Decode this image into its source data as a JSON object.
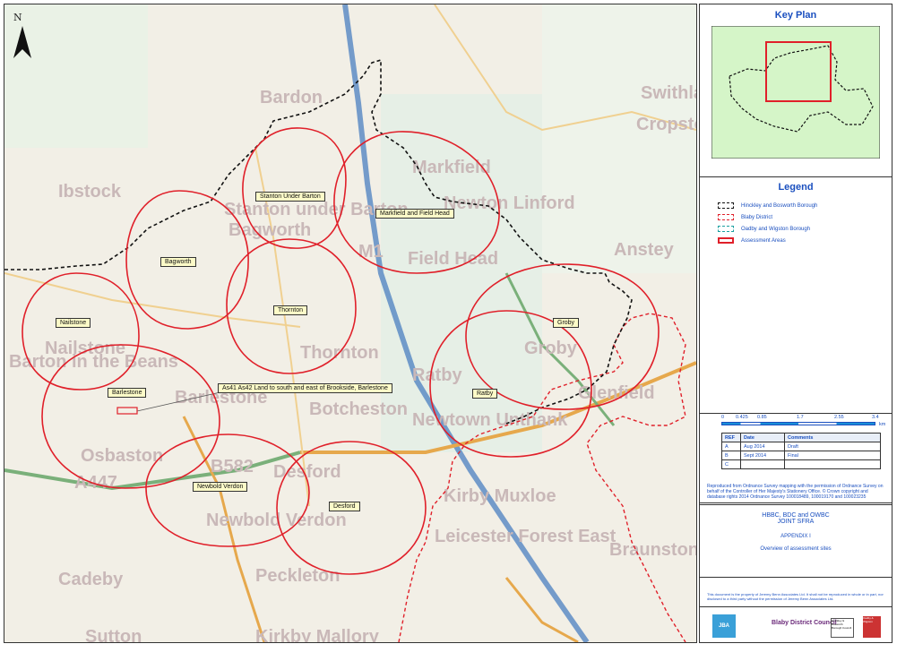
{
  "map": {
    "north_label": "N",
    "site_labels": [
      {
        "id": "stanton",
        "text": "Stanton Under Barton"
      },
      {
        "id": "markfield",
        "text": "Markfield and Field Head"
      },
      {
        "id": "bagworth",
        "text": "Bagworth"
      },
      {
        "id": "thornton",
        "text": "Thornton"
      },
      {
        "id": "nailstone",
        "text": "Nailstone"
      },
      {
        "id": "groby",
        "text": "Groby"
      },
      {
        "id": "barlestone",
        "text": "Barlestone"
      },
      {
        "id": "as41",
        "text": "As41 As42 Land to south and east of Brookside, Barlestone"
      },
      {
        "id": "ratby",
        "text": "Ratby"
      },
      {
        "id": "newbold",
        "text": "Newbold Verdon"
      },
      {
        "id": "desford",
        "text": "Desford"
      }
    ],
    "place_names": [
      "Ibstock",
      "Stanton under Barton",
      "Bagworth",
      "Thornton",
      "Markfield",
      "Field Head",
      "Nailstone",
      "Barton in the Beans",
      "Barlestone",
      "Botcheston",
      "Newtown Unthank",
      "Ratby",
      "Groby",
      "Glenfield",
      "Anstey",
      "Cropston",
      "Swithland",
      "Kirby Muxloe",
      "Leicester Forest East",
      "Osbaston",
      "Newbold Verdon",
      "Desford",
      "Cadeby",
      "Peckleton",
      "Sutton",
      "Kirkby Mallory",
      "Braunstone Town",
      "Bardon",
      "Newton Linford",
      "A447",
      "B582",
      "M1"
    ]
  },
  "panel": {
    "key_plan_title": "Key Plan",
    "legend_title": "Legend",
    "legend_items": [
      {
        "label": "Hinckley and Bosworth Borough",
        "color": "#111111",
        "style": "dashed"
      },
      {
        "label": "Blaby District",
        "color": "#e0202a",
        "style": "dashed"
      },
      {
        "label": "Oadby and Wigston Borough",
        "color": "#1aa0a0",
        "style": "dashed"
      },
      {
        "label": "Assessment Areas",
        "color": "#e0202a",
        "style": "box"
      }
    ],
    "scale": {
      "ticks": [
        "0",
        "0.425",
        "0.85",
        "1.7",
        "2.55",
        "3.4"
      ],
      "unit": "km"
    },
    "revisions": {
      "headers": [
        "REF",
        "Date",
        "Comments"
      ],
      "rows": [
        [
          "A",
          "Aug 2014",
          "Draft"
        ],
        [
          "B",
          "Sept 2014",
          "Final"
        ],
        [
          "C",
          "",
          ""
        ]
      ]
    },
    "copyright": "Reproduced from Ordnance Survey mapping with the permission of Ordnance Survey on behalf of the Controller of Her Majesty's Stationery Office. © Crown copyright and database rights 2014 Ordnance Survey 100018489, 100019170 and 100023235",
    "project_title": "HBBC, BDC and OWBC\nJOINT SFRA",
    "appendix": "APPENDIX I",
    "subtitle": "Overview of assessment sites",
    "disclaimer": "This document is the property of Jeremy Benn Associates Ltd. It shall not be reproduced in whole or in part, nor disclosed to a third party without the permission of Jeremy Benn Associates Ltd.",
    "logos": [
      "JBA consulting",
      "Blaby District Council",
      "Hinckley & Bosworth Borough Council",
      "Oadby & Wigston"
    ]
  }
}
